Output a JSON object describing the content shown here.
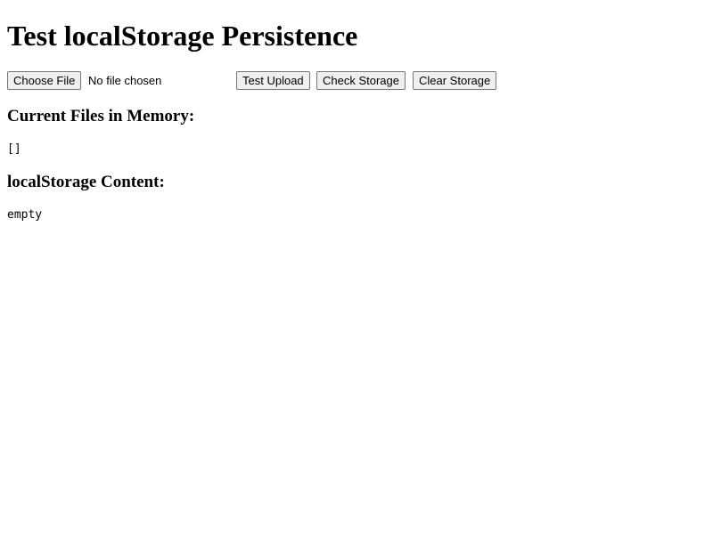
{
  "page": {
    "title": "Test localStorage Persistence"
  },
  "controls": {
    "choose_file_label": "Choose File",
    "file_status": "No file chosen",
    "test_upload_label": "Test Upload",
    "check_storage_label": "Check Storage",
    "clear_storage_label": "Clear Storage"
  },
  "memory": {
    "heading": "Current Files in Memory:",
    "content": "[]"
  },
  "storage": {
    "heading": "localStorage Content:",
    "content": "empty"
  }
}
